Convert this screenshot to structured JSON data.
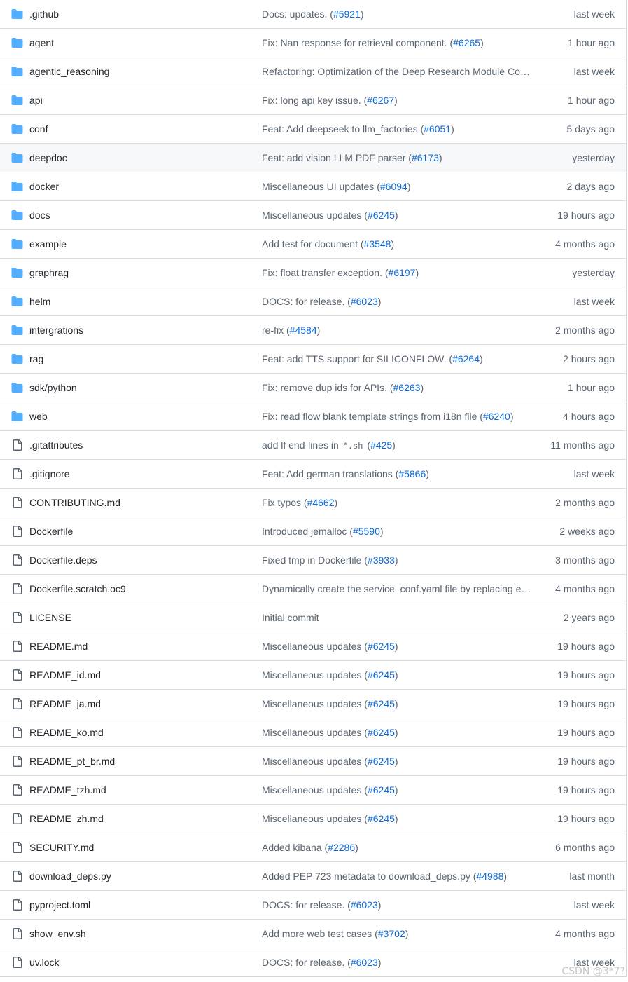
{
  "colors": {
    "folder": "#54aeff",
    "file_icon": "#59636e",
    "link": "#0969da",
    "text": "#1f2328",
    "muted": "#59636e"
  },
  "rows": [
    {
      "type": "folder",
      "name": ".github",
      "msg": "Docs: updates. (",
      "pr": "#5921",
      "msg_end": ")",
      "age": "last week"
    },
    {
      "type": "folder",
      "name": "agent",
      "msg": "Fix: Nan response for retrieval component. (",
      "pr": "#6265",
      "msg_end": ")",
      "age": "1 hour ago"
    },
    {
      "type": "folder",
      "name": "agentic_reasoning",
      "msg": "Refactoring: Optimization of the Deep Research Module Cod…",
      "pr": "",
      "msg_end": "",
      "age": "last week"
    },
    {
      "type": "folder",
      "name": "api",
      "msg": "Fix: long api key issue. (",
      "pr": "#6267",
      "msg_end": ")",
      "age": "1 hour ago"
    },
    {
      "type": "folder",
      "name": "conf",
      "msg": "Feat: Add deepseek to llm_factories (",
      "pr": "#6051",
      "msg_end": ")",
      "age": "5 days ago"
    },
    {
      "type": "folder",
      "name": "deepdoc",
      "msg": "Feat: add vision LLM PDF parser (",
      "pr": "#6173",
      "msg_end": ")",
      "age": "yesterday",
      "hover": true
    },
    {
      "type": "folder",
      "name": "docker",
      "msg": "Miscellaneous UI updates (",
      "pr": "#6094",
      "msg_end": ")",
      "age": "2 days ago"
    },
    {
      "type": "folder",
      "name": "docs",
      "msg": "Miscellaneous updates (",
      "pr": "#6245",
      "msg_end": ")",
      "age": "19 hours ago"
    },
    {
      "type": "folder",
      "name": "example",
      "msg": "Add test for document (",
      "pr": "#3548",
      "msg_end": ")",
      "age": "4 months ago"
    },
    {
      "type": "folder",
      "name": "graphrag",
      "msg": "Fix: float transfer exception. (",
      "pr": "#6197",
      "msg_end": ")",
      "age": "yesterday"
    },
    {
      "type": "folder",
      "name": "helm",
      "msg": "DOCS: for release. (",
      "pr": "#6023",
      "msg_end": ")",
      "age": "last week"
    },
    {
      "type": "folder",
      "name": "intergrations",
      "msg": "re-fix (",
      "pr": "#4584",
      "msg_end": ")",
      "age": "2 months ago"
    },
    {
      "type": "folder",
      "name": "rag",
      "msg": "Feat: add TTS support for SILICONFLOW. (",
      "pr": "#6264",
      "msg_end": ")",
      "age": "2 hours ago"
    },
    {
      "type": "folder",
      "name": "sdk/python",
      "msg": "Fix: remove dup ids for APIs. (",
      "pr": "#6263",
      "msg_end": ")",
      "age": "1 hour ago"
    },
    {
      "type": "folder",
      "name": "web",
      "msg": "Fix: read flow blank template strings from i18n file (",
      "pr": "#6240",
      "msg_end": ")",
      "age": "4 hours ago"
    },
    {
      "type": "file",
      "name": ".gitattributes",
      "msg": "add lf end-lines in ",
      "code": "*.sh",
      "msg_mid": " (",
      "pr": "#425",
      "msg_end": ")",
      "age": "11 months ago"
    },
    {
      "type": "file",
      "name": ".gitignore",
      "msg": "Feat: Add german translations (",
      "pr": "#5866",
      "msg_end": ")",
      "age": "last week"
    },
    {
      "type": "file",
      "name": "CONTRIBUTING.md",
      "msg": "Fix typos (",
      "pr": "#4662",
      "msg_end": ")",
      "age": "2 months ago"
    },
    {
      "type": "file",
      "name": "Dockerfile",
      "msg": "Introduced jemalloc (",
      "pr": "#5590",
      "msg_end": ")",
      "age": "2 weeks ago"
    },
    {
      "type": "file",
      "name": "Dockerfile.deps",
      "msg": "Fixed tmp in Dockerfile (",
      "pr": "#3933",
      "msg_end": ")",
      "age": "3 months ago"
    },
    {
      "type": "file",
      "name": "Dockerfile.scratch.oc9",
      "msg": "Dynamically create the service_conf.yaml file by replacing en…",
      "pr": "",
      "msg_end": "",
      "age": "4 months ago"
    },
    {
      "type": "file",
      "name": "LICENSE",
      "msg": "Initial commit",
      "pr": "",
      "msg_end": "",
      "age": "2 years ago"
    },
    {
      "type": "file",
      "name": "README.md",
      "msg": "Miscellaneous updates (",
      "pr": "#6245",
      "msg_end": ")",
      "age": "19 hours ago"
    },
    {
      "type": "file",
      "name": "README_id.md",
      "msg": "Miscellaneous updates (",
      "pr": "#6245",
      "msg_end": ")",
      "age": "19 hours ago"
    },
    {
      "type": "file",
      "name": "README_ja.md",
      "msg": "Miscellaneous updates (",
      "pr": "#6245",
      "msg_end": ")",
      "age": "19 hours ago"
    },
    {
      "type": "file",
      "name": "README_ko.md",
      "msg": "Miscellaneous updates (",
      "pr": "#6245",
      "msg_end": ")",
      "age": "19 hours ago"
    },
    {
      "type": "file",
      "name": "README_pt_br.md",
      "msg": "Miscellaneous updates (",
      "pr": "#6245",
      "msg_end": ")",
      "age": "19 hours ago"
    },
    {
      "type": "file",
      "name": "README_tzh.md",
      "msg": "Miscellaneous updates (",
      "pr": "#6245",
      "msg_end": ")",
      "age": "19 hours ago"
    },
    {
      "type": "file",
      "name": "README_zh.md",
      "msg": "Miscellaneous updates (",
      "pr": "#6245",
      "msg_end": ")",
      "age": "19 hours ago"
    },
    {
      "type": "file",
      "name": "SECURITY.md",
      "msg": "Added kibana (",
      "pr": "#2286",
      "msg_end": ")",
      "age": "6 months ago"
    },
    {
      "type": "file",
      "name": "download_deps.py",
      "msg": "Added PEP 723 metadata to download_deps.py (",
      "pr": "#4988",
      "msg_end": ")",
      "age": "last month"
    },
    {
      "type": "file",
      "name": "pyproject.toml",
      "msg": "DOCS: for release. (",
      "pr": "#6023",
      "msg_end": ")",
      "age": "last week"
    },
    {
      "type": "file",
      "name": "show_env.sh",
      "msg": "Add more web test cases (",
      "pr": "#3702",
      "msg_end": ")",
      "age": "4 months ago"
    },
    {
      "type": "file",
      "name": "uv.lock",
      "msg": "DOCS: for release. (",
      "pr": "#6023",
      "msg_end": ")",
      "age": "last week"
    }
  ],
  "watermark": "CSDN @3*7?"
}
